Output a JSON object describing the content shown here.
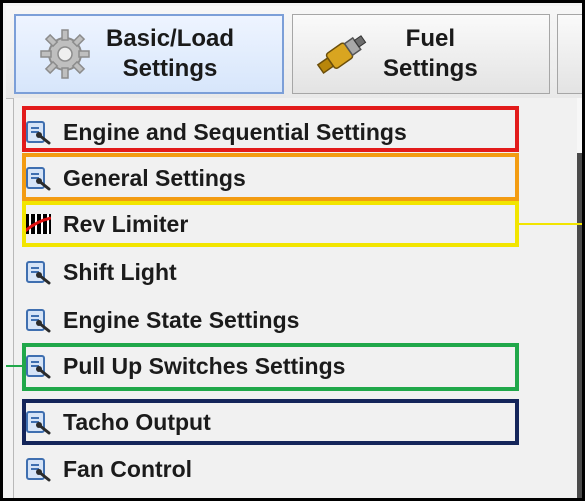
{
  "toolbar": {
    "basic_line1": "Basic/Load",
    "basic_line2": "Settings",
    "fuel_line1": "Fuel",
    "fuel_line2": "Settings"
  },
  "menu": {
    "items": [
      {
        "label": "Engine and Sequential Settings",
        "icon": "settings-wrench-icon"
      },
      {
        "label": "General Settings",
        "icon": "settings-wrench-icon"
      },
      {
        "label": "Rev Limiter",
        "icon": "rev-limiter-icon"
      },
      {
        "label": "Shift Light",
        "icon": "settings-wrench-icon"
      },
      {
        "label": "Engine State Settings",
        "icon": "settings-wrench-icon"
      },
      {
        "label": "Pull Up Switches Settings",
        "icon": "settings-wrench-icon"
      },
      {
        "label": "Tacho Output",
        "icon": "settings-wrench-icon"
      },
      {
        "label": "Fan Control",
        "icon": "settings-wrench-icon"
      }
    ]
  },
  "highlights": {
    "colors": {
      "red": "#e21b1b",
      "orange": "#f39c12",
      "yellow": "#f2e500",
      "green": "#20a84a",
      "navy": "#14255a"
    }
  }
}
